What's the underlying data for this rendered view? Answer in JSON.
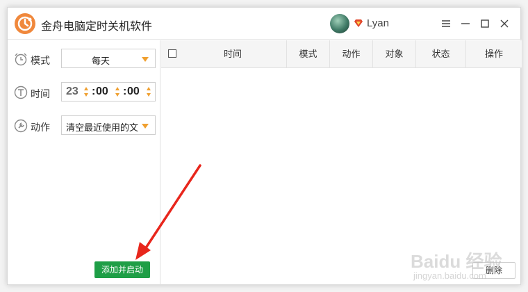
{
  "app": {
    "title": "金舟电脑定时关机软件"
  },
  "user": {
    "name": "Lyan"
  },
  "form": {
    "mode_label": "模式",
    "mode_value": "每天",
    "time_label": "时间",
    "time_hour": "23",
    "time_minute": "00",
    "time_second": "00",
    "time_sep": ":",
    "action_label": "动作",
    "action_value": "清空最近使用的文..."
  },
  "buttons": {
    "add_start": "添加并启动",
    "delete": "删除"
  },
  "table": {
    "columns": [
      "时间",
      "模式",
      "动作",
      "对象",
      "状态",
      "操作"
    ],
    "rows": []
  },
  "watermark": {
    "main": "Baidu 经验",
    "sub": "jingyan.baidu.com"
  },
  "colors": {
    "accent_orange": "#f0883c",
    "add_button": "#1e9e46",
    "spinner": "#f0a030",
    "annotation_arrow": "#e8261c"
  }
}
